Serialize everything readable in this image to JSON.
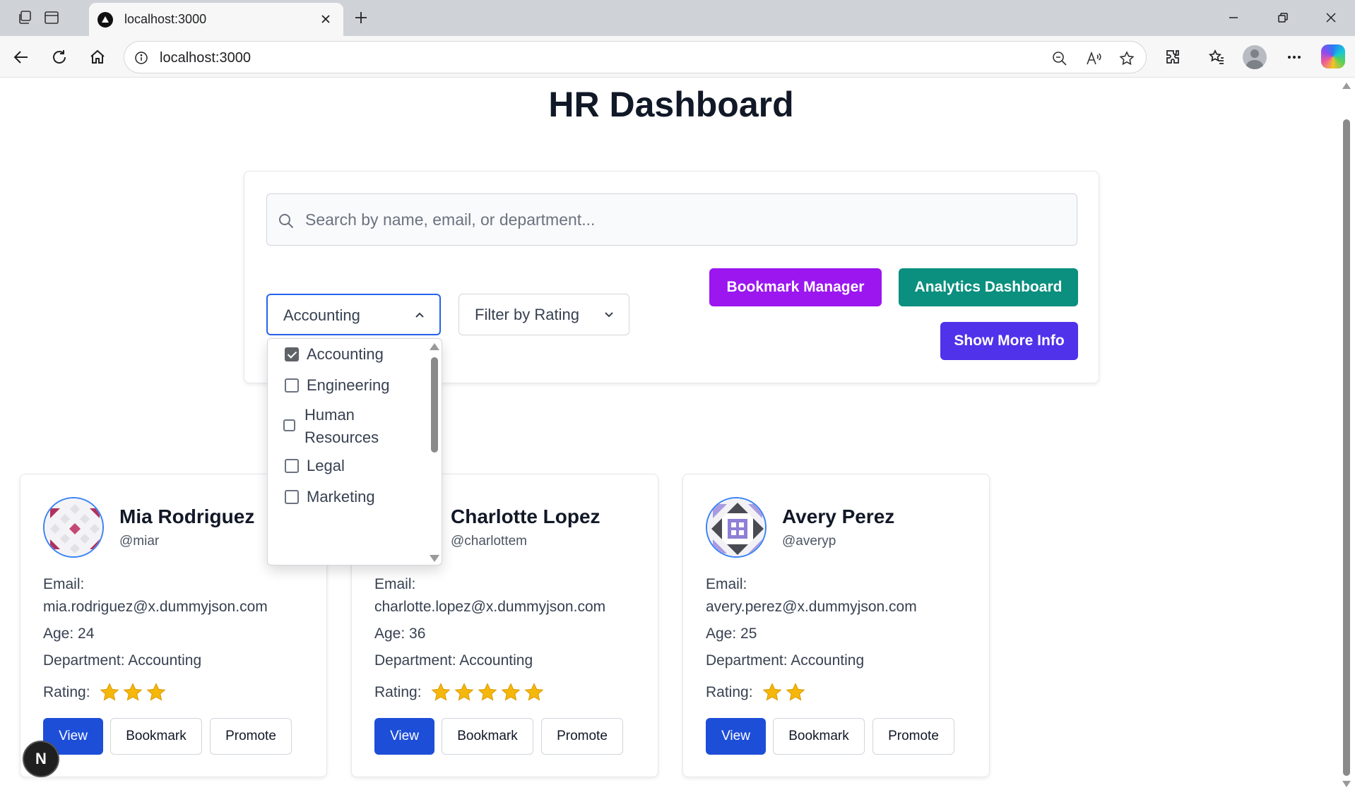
{
  "browser": {
    "tab_title": "localhost:3000",
    "url": "localhost:3000"
  },
  "page": {
    "title": "HR Dashboard"
  },
  "search": {
    "placeholder": "Search by name, email, or department..."
  },
  "filters": {
    "department_selected": "Accounting",
    "rating_label": "Filter by Rating"
  },
  "buttons": {
    "bookmark_manager": "Bookmark Manager",
    "analytics_dashboard": "Analytics Dashboard",
    "show_more_info": "Show More Info"
  },
  "department_dropdown": {
    "options": [
      {
        "label": "Accounting",
        "checked": true
      },
      {
        "label": "Engineering",
        "checked": false
      },
      {
        "label": "Human Resources",
        "checked": false
      },
      {
        "label": "Legal",
        "checked": false
      },
      {
        "label": "Marketing",
        "checked": false
      }
    ]
  },
  "labels": {
    "email": "Email:",
    "rating": "Rating:",
    "view": "View",
    "bookmark": "Bookmark",
    "promote": "Promote"
  },
  "employees": [
    {
      "name": "Mia Rodriguez",
      "username": "@miar",
      "email": "mia.rodriguez@x.dummyjson.com",
      "age": "Age: 24",
      "department": "Department: Accounting",
      "rating": 3
    },
    {
      "name": "Charlotte Lopez",
      "username": "@charlottem",
      "email": "charlotte.lopez@x.dummyjson.com",
      "age": "Age: 36",
      "department": "Department: Accounting",
      "rating": 5
    },
    {
      "name": "Avery Perez",
      "username": "@averyp",
      "email": "avery.perez@x.dummyjson.com",
      "age": "Age: 25",
      "department": "Department: Accounting",
      "rating": 2
    }
  ],
  "dev_badge": "N",
  "colors": {
    "bookmark_manager": "#9b16ef",
    "analytics_dashboard": "#0b8f7e",
    "show_more_info": "#4f32ea",
    "view_button": "#1d4ed8",
    "star": "#f5b70a"
  },
  "icons": [
    "tab-actions-icon",
    "vertical-tabs-icon",
    "close-icon",
    "plus-icon",
    "minimize-icon",
    "restore-icon",
    "back-icon",
    "refresh-icon",
    "home-icon",
    "info-icon",
    "zoom-out-icon",
    "read-aloud-icon",
    "favorite-icon",
    "extensions-icon",
    "favorites-icon",
    "more-icon",
    "search-icon",
    "chevron-up-icon",
    "chevron-down-icon",
    "star-icon"
  ]
}
